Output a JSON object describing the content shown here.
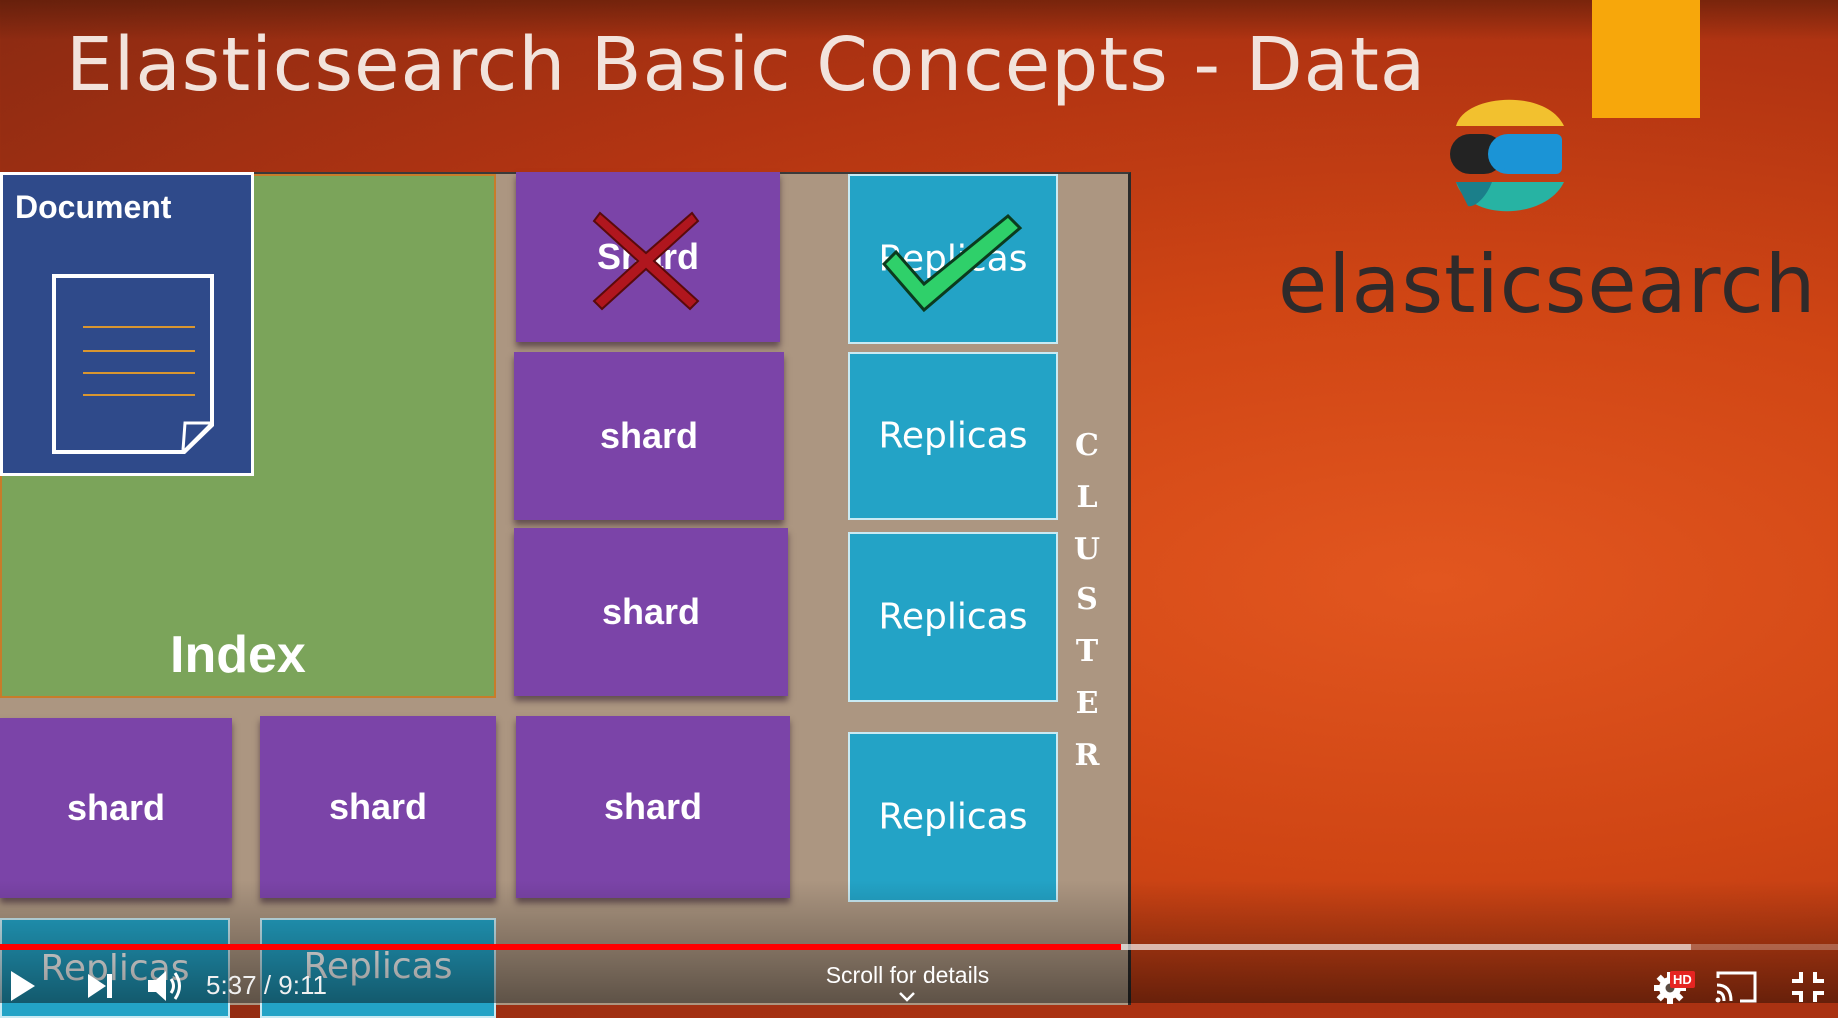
{
  "slide": {
    "title": "Elasticsearch Basic Concepts - Data",
    "brand_wordmark": "elasticsearch",
    "document_label": "Document",
    "index_label": "Index",
    "shard_label": "shard",
    "shard_label_crossed": "Shard",
    "replica_label": "Replicas",
    "cluster_letters": [
      "C",
      "L",
      "U",
      "S",
      "T",
      "E",
      "R"
    ],
    "colors": {
      "background": "#cf4514",
      "index": "#7ba45a",
      "document": "#2f4a8a",
      "shard": "#7b44a8",
      "replica": "#23a3c6",
      "cluster": "#ac9681",
      "cross": "#b0161e",
      "check": "#2fd06a"
    }
  },
  "player": {
    "current_time": "5:37",
    "duration": "9:11",
    "time_display": "5:37 / 9:11",
    "played_fraction": 0.61,
    "buffered_fraction": 0.92,
    "scroll_hint": "Scroll for details",
    "quality_badge": "HD",
    "accent_color": "#ff0000",
    "icons": [
      "play-icon",
      "next-icon",
      "volume-icon",
      "settings-icon",
      "cast-icon",
      "exit-fullscreen-icon",
      "chevron-down-icon"
    ]
  }
}
